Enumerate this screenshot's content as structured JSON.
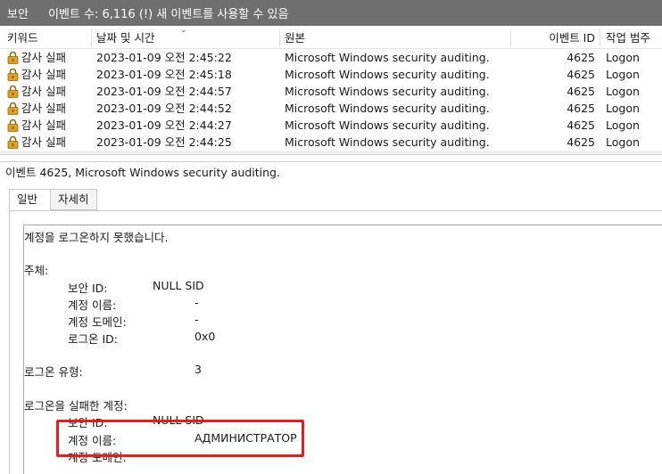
{
  "titlebar": {
    "log_name": "보안",
    "count_text": "이벤트 수: 6,116 (!) 새 이벤트를 사용할 수 있음"
  },
  "columns": {
    "keyword": "키워드",
    "date": "날짜 및 시간",
    "source": "원본",
    "event_id": "이벤트 ID",
    "category": "작업 범주"
  },
  "events": [
    {
      "keyword": "감사 실패",
      "date": "2023-01-09 오전 2:45:22",
      "source": "Microsoft Windows security auditing.",
      "event_id": "4625",
      "category": "Logon"
    },
    {
      "keyword": "감사 실패",
      "date": "2023-01-09 오전 2:45:18",
      "source": "Microsoft Windows security auditing.",
      "event_id": "4625",
      "category": "Logon"
    },
    {
      "keyword": "감사 실패",
      "date": "2023-01-09 오전 2:44:57",
      "source": "Microsoft Windows security auditing.",
      "event_id": "4625",
      "category": "Logon"
    },
    {
      "keyword": "감사 실패",
      "date": "2023-01-09 오전 2:44:52",
      "source": "Microsoft Windows security auditing.",
      "event_id": "4625",
      "category": "Logon"
    },
    {
      "keyword": "감사 실패",
      "date": "2023-01-09 오전 2:44:27",
      "source": "Microsoft Windows security auditing.",
      "event_id": "4625",
      "category": "Logon"
    },
    {
      "keyword": "감사 실패",
      "date": "2023-01-09 오전 2:44:25",
      "source": "Microsoft Windows security auditing.",
      "event_id": "4625",
      "category": "Logon"
    }
  ],
  "detail": {
    "title": "이벤트 4625, Microsoft Windows security auditing.",
    "tabs": [
      "일반",
      "자세히"
    ],
    "message": "계정을 로그온하지 못했습니다.",
    "subject_heading": "주체:",
    "subject": {
      "security_id_label": "보안 ID:",
      "security_id_value": "NULL SID",
      "account_name_label": "계정 이름:",
      "account_name_value": "-",
      "account_domain_label": "계정 도메인:",
      "account_domain_value": "-",
      "logon_id_label": "로그온 ID:",
      "logon_id_value": "0x0"
    },
    "logon_type_label": "로그온 유형:",
    "logon_type_value": "3",
    "failed_heading": "로그온을 실패한 계정:",
    "failed": {
      "security_id_label": "보안 ID:",
      "security_id_value": "NULL SID",
      "account_name_label": "계정 이름:",
      "account_name_value": "АДМИНИСТРАТОР",
      "account_domain_label": "계정 도메인:"
    }
  },
  "colors": {
    "titlebar_bg": "#6f6f6f",
    "highlight": "#e02020",
    "lock_icon": "#e0a020"
  }
}
